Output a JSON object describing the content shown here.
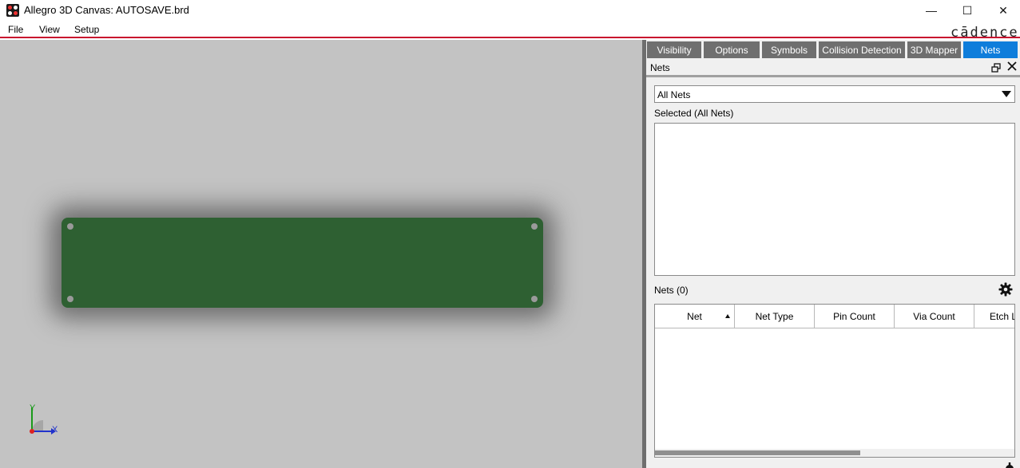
{
  "window": {
    "title": "Allegro 3D Canvas: AUTOSAVE.brd",
    "min_glyph": "—",
    "max_glyph": "☐",
    "close_glyph": "✕"
  },
  "menu": {
    "items": [
      "File",
      "View",
      "Setup"
    ]
  },
  "brand": {
    "logo_text": "cādence"
  },
  "canvas": {
    "background": "#c3c3c3",
    "board_color": "#2e6032",
    "axis": {
      "x_label": "X",
      "y_label": "Y"
    }
  },
  "panel": {
    "tabs": [
      {
        "label": "Visibility",
        "active": false
      },
      {
        "label": "Options",
        "active": false
      },
      {
        "label": "Symbols",
        "active": false
      },
      {
        "label": "Collision Detection",
        "active": false
      },
      {
        "label": "3D Mapper",
        "active": false
      },
      {
        "label": "Nets",
        "active": true
      }
    ],
    "dock_title": "Nets",
    "filter": {
      "value": "All Nets"
    },
    "selected_label": "Selected (All Nets)",
    "nets_label": "Nets (0)",
    "table": {
      "columns": [
        "Net",
        "Net Type",
        "Pin Count",
        "Via Count",
        "Etch L"
      ],
      "rows": []
    },
    "accent_color": "#0e7ddb"
  }
}
